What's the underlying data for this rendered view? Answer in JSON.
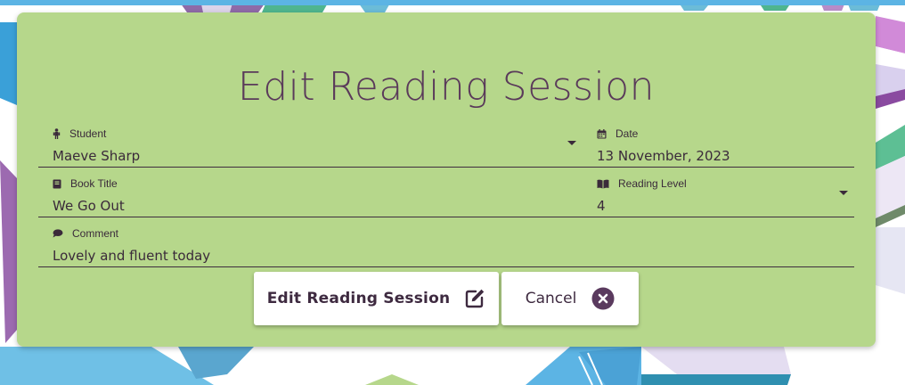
{
  "form": {
    "title": "Edit Reading Session",
    "student": {
      "label": "Student",
      "value": "Maeve Sharp",
      "icon": "person-icon"
    },
    "date": {
      "label": "Date",
      "value": "13 November, 2023",
      "icon": "calendar-icon"
    },
    "book_title": {
      "label": "Book Title",
      "value": "We Go Out",
      "icon": "book-icon"
    },
    "reading_level": {
      "label": "Reading Level",
      "value": "4",
      "icon": "open-book-icon"
    },
    "comment": {
      "label": "Comment",
      "value": "Lovely and fluent today",
      "icon": "comment-icon"
    }
  },
  "buttons": {
    "submit_label": "Edit Reading Session",
    "submit_icon": "edit-icon",
    "cancel_label": "Cancel",
    "cancel_icon": "close-circle-icon"
  },
  "colors": {
    "card_background": "#b6d78b",
    "title_text": "#5a3a5a",
    "text": "#3a2a3a",
    "top_bar": "#5cb4e4",
    "button_background": "#ffffff"
  }
}
